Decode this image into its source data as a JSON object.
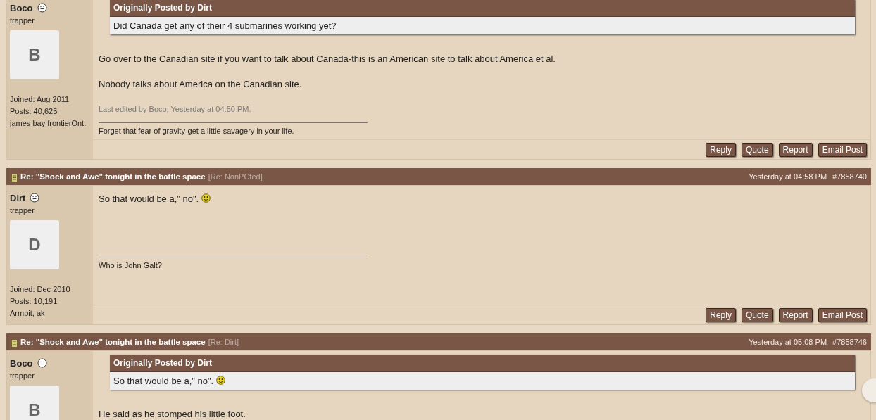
{
  "posts": [
    {
      "user": {
        "name": "Boco",
        "online": false,
        "title": "trapper",
        "avatar_letter": "B",
        "joined": "Joined: Aug 2011",
        "posts": "Posts: 40,625",
        "location": "james bay frontierOnt."
      },
      "quote": {
        "label": "Originally Posted by Dirt",
        "text": "Did Canada get any of their 4 submarines working yet?",
        "smiley": false
      },
      "paragraphs": [
        {
          "text": "Go over to the Canadian site if you want to talk about Canada-this is an American site to talk about America et al.",
          "smiley": false
        },
        {
          "text": "Nobody talks about America on the Canadian site.",
          "smiley": false
        }
      ],
      "edited": "Last edited by Boco; Yesterday at 04:50 PM.",
      "signature": "Forget that fear of gravity-get a little savagery in your life.",
      "buttons": [
        "Reply",
        "Quote",
        "Report",
        "Email Post"
      ]
    },
    {
      "header": {
        "title": "Re: \"Shock and Awe\" tonight in the battle space",
        "reply_to": "[Re: NonPCfed]",
        "date": "Yesterday at 04:58 PM",
        "number": "#7858740"
      },
      "user": {
        "name": "Dirt",
        "online": false,
        "title": "trapper",
        "avatar_letter": "D",
        "joined": "Joined: Dec 2010",
        "posts": "Posts: 10,191",
        "location": "Armpit, ak"
      },
      "paragraphs": [
        {
          "text": "So that would be a,\" no\".",
          "smiley": true
        }
      ],
      "signature": "Who is John Galt?",
      "buttons": [
        "Reply",
        "Quote",
        "Report",
        "Email Post"
      ]
    },
    {
      "header": {
        "title": "Re: \"Shock and Awe\" tonight in the battle space",
        "reply_to": "[Re: Dirt]",
        "date": "Yesterday at 05:08 PM",
        "number": "#7858746"
      },
      "user": {
        "name": "Boco",
        "online": false,
        "title": "trapper",
        "avatar_letter": "B"
      },
      "quote": {
        "label": "Originally Posted by Dirt",
        "text": "So that would be a,\" no\".",
        "smiley": true
      },
      "paragraphs": [
        {
          "text": "He said as he stomped his little foot.",
          "smiley": false
        }
      ]
    }
  ]
}
